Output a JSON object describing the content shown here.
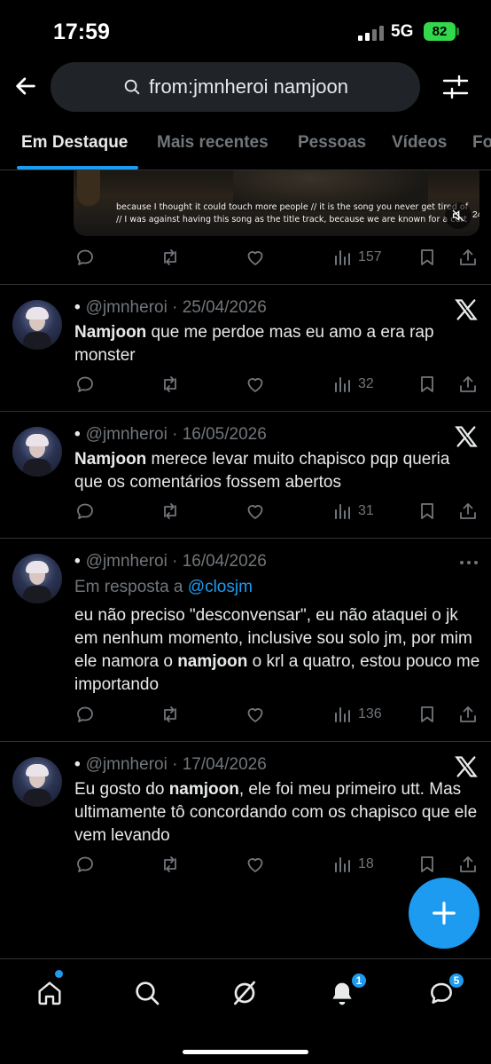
{
  "status_bar": {
    "time": "17:59",
    "network": "5G",
    "battery": "82"
  },
  "header": {
    "search_query": "from:jmnheroi namjoon"
  },
  "tabs": [
    {
      "label": "Em Destaque",
      "active": true
    },
    {
      "label": "Mais recentes",
      "active": false
    },
    {
      "label": "Pessoas",
      "active": false
    },
    {
      "label": "Vídeos",
      "active": false
    },
    {
      "label": "Fo",
      "active": false
    }
  ],
  "media": {
    "subtitle_line1": "because I thought it could touch more people // it is the song you never get tired of",
    "subtitle_line2": "// I was against having this song as the title track, because we are known for a cert",
    "views": "24"
  },
  "first_tweet_actions": {
    "views": "157"
  },
  "tweets": [
    {
      "dot": "•",
      "handle": "@jmnheroi",
      "separator": "·",
      "date": "25/04/2026",
      "bold": "Namjoon",
      "text": " que me perdoe mas eu amo a era rap monster",
      "views": "32"
    },
    {
      "dot": "•",
      "handle": "@jmnheroi",
      "separator": "·",
      "date": "16/05/2026",
      "bold": "Namjoon",
      "text": " merece levar muito chapisco pqp queria que os comentários fossem abertos",
      "views": "31"
    },
    {
      "dot": "•",
      "handle": "@jmnheroi",
      "separator": "·",
      "date": "16/04/2026",
      "reply_prefix": "Em resposta a",
      "reply_handle": "@closjm",
      "text_before": "eu não preciso \"desconvensar\",  eu não ataquei o jk em nenhum momento, inclusive sou solo jm, por mim ele namora o ",
      "bold": "namjoon",
      "text_after": " o krl a quatro, estou pouco me importando",
      "views": "136"
    },
    {
      "dot": "•",
      "handle": "@jmnheroi",
      "separator": "·",
      "date": "17/04/2026",
      "text_before": "Eu gosto do ",
      "bold": "namjoon",
      "text_after": ", ele foi meu primeiro utt. Mas ultimamente tô concordando com os chapisco que ele vem levando",
      "views": "18"
    }
  ],
  "bottom_nav": {
    "notifications_badge": "1",
    "messages_badge": "5"
  },
  "colors": {
    "accent": "#1d9bf0",
    "muted": "#71767b",
    "text": "#e7e9ea",
    "battery": "#32d74b"
  }
}
